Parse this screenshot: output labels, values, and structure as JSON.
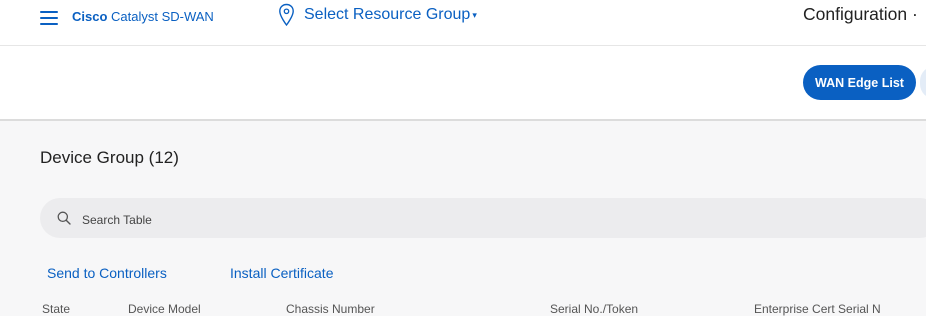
{
  "header": {
    "brand_bold": "Cisco",
    "brand_rest": " Catalyst SD-WAN",
    "resource_group": "Select Resource Group",
    "caret": "▾",
    "page_title": "Configuration ·"
  },
  "actions": {
    "wan_edge_list": "WAN Edge List"
  },
  "main": {
    "section_title": "Device Group (12)",
    "search_placeholder": "Search Table",
    "links": [
      "Send to Controllers",
      "Install Certificate"
    ],
    "columns": [
      "State",
      "Device Model",
      "Chassis Number",
      "Serial No./Token",
      "Enterprise Cert Serial N"
    ]
  },
  "colors": {
    "accent": "#0a60c2",
    "background": "#f7f7f8",
    "search_bg": "#ececee"
  },
  "icons": {
    "menu": "hamburger-menu-icon",
    "location": "location-pin-icon",
    "search": "search-icon"
  }
}
